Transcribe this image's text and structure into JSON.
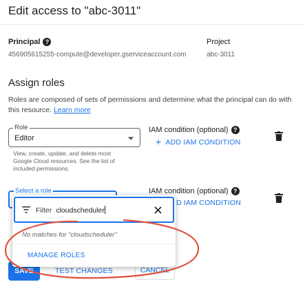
{
  "dialog": {
    "title": "Edit access to \"abc-3011\""
  },
  "principal": {
    "label": "Principal",
    "value": "456905615255-compute@developer.gserviceaccount.com"
  },
  "project": {
    "label": "Project",
    "value": "abc-3011"
  },
  "assign_roles": {
    "heading": "Assign roles",
    "description": "Roles are composed of sets of permissions and determine what the principal can do with this resource.",
    "learn_more": "Learn more"
  },
  "role_1": {
    "label": "Role",
    "value": "Editor",
    "help_line_1": "View, create, update, and delete most",
    "help_line_2": "Google Cloud resources. See the list of",
    "help_line_3": "included permissions.",
    "condition_label": "IAM condition (optional)",
    "add_condition": "ADD IAM CONDITION"
  },
  "role_2": {
    "label": "Select a role",
    "condition_label": "IAM condition (optional)",
    "add_condition": "D IAM CONDITION"
  },
  "role_popup": {
    "filter_label": "Filter",
    "filter_value": "cloudscheduler",
    "no_matches": "No matches for \"cloudscheduler\"",
    "manage_roles": "MANAGE ROLES"
  },
  "footer": {
    "save": "SAVE",
    "test_changes": "TEST CHANGES",
    "cancel": "CANCEL"
  },
  "colors": {
    "accent": "#1a73e8",
    "highlight_ring": "#e2533f"
  }
}
